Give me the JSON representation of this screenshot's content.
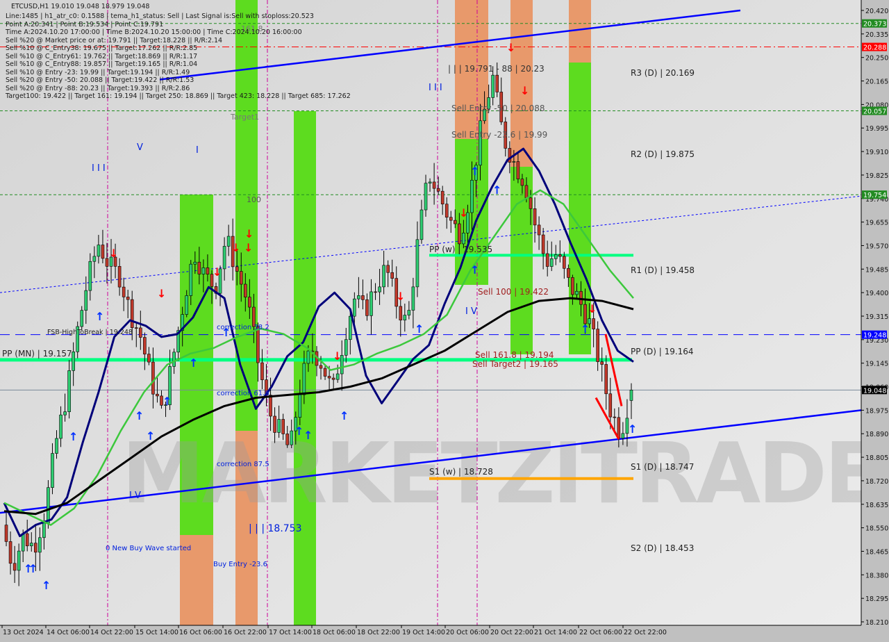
{
  "header": {
    "symbol_line": "ETCUSD,H1  19.010 19.048 18.979 19.048",
    "info_lines": [
      "Line:1485 | h1_atr_c0: 0.1588 | tema_h1_status: Sell | Last Signal is:Sell with stoploss:20.523",
      "Point A:20.341 | Point B:19.534 | Point C:19.791",
      "Time A:2024.10.20 17:00:00 | Time B:2024.10.20 15:00:00 | Time C:2024.10.20 16:00:00",
      "Sell %20 @ Market price or at: 19.791 || Target:18.228 || R/R:2.14",
      "Sell %10 @ C_Entry38: 19.675 || Target:17.262 || R/R:2.85",
      "Sell %10 @ C_Entry61: 19.762 || Target:18.869 || R/R:1.17",
      "Sell %10 @ C_Entry88: 19.857 || Target:19.165 || R/R:1.04",
      "Sell %10 @ Entry -23: 19.99 || Target:19.194 || R/R:1.49",
      "Sell %20 @ Entry -50: 20.088 || Target:19.422 || R/R:1.53",
      "Sell %20 @ Entry -88: 20.23 || Target:19.393 || R/R:2.86",
      "Target100: 19.422 || Target 161: 19.194 || Target 250: 18.869 || Target 423: 18.228 || Target 685: 17.262"
    ]
  },
  "watermark": "MARKETZITRADE",
  "colors": {
    "background": "#d8d8d8",
    "bull_candle": "#2ecc71",
    "bear_candle": "#c0392b",
    "green_zone": "#5ddc1f",
    "orange_zone": "#e8996b",
    "pivot_line": "#00ff80",
    "s1w_line": "#ffa500",
    "channel": "#0000ff",
    "ma_fast": "#00007a",
    "ma_mid": "#3cc83c",
    "ma_slow": "#000000",
    "price_tag": "#000000",
    "red_tag": "#ff0000",
    "green_tag": "#228b22",
    "blue_tag": "#0000ff"
  },
  "chart_data": {
    "type": "candlestick",
    "title": "ETCUSD,H1",
    "ylim": [
      18.21,
      20.42
    ],
    "y_ticks": [
      "20.420",
      "20.335",
      "20.250",
      "20.165",
      "20.080",
      "19.995",
      "19.910",
      "19.825",
      "19.740",
      "19.655",
      "19.570",
      "19.485",
      "19.400",
      "19.315",
      "19.230",
      "19.145",
      "19.060",
      "18.975",
      "18.890",
      "18.805",
      "18.720",
      "18.635",
      "18.550",
      "18.465",
      "18.380",
      "18.295",
      "18.210"
    ],
    "x_ticks": [
      "13 Oct 2024",
      "14 Oct 06:00",
      "14 Oct 22:00",
      "15 Oct 14:00",
      "16 Oct 06:00",
      "16 Oct 22:00",
      "17 Oct 14:00",
      "18 Oct 06:00",
      "18 Oct 22:00",
      "19 Oct 14:00",
      "20 Oct 06:00",
      "20 Oct 22:00",
      "21 Oct 14:00",
      "22 Oct 06:00",
      "22 Oct 22:00"
    ],
    "last_price": 19.048,
    "ohlc_last": {
      "open": 19.01,
      "high": 19.048,
      "low": 18.979,
      "close": 19.048
    },
    "price_tags": [
      {
        "value": 20.373,
        "label": "20.373",
        "kind": "green"
      },
      {
        "value": 20.288,
        "label": "20.288",
        "kind": "red"
      },
      {
        "value": 20.057,
        "label": "20.057",
        "kind": "green"
      },
      {
        "value": 19.754,
        "label": "19.754",
        "kind": "green"
      },
      {
        "value": 19.248,
        "label": "19.248",
        "kind": "blue"
      },
      {
        "value": 19.048,
        "label": "19.048",
        "kind": "price"
      }
    ],
    "levels": [
      {
        "name": "R3 (D)",
        "value": 20.169,
        "label": "R3 (D) | 20.169"
      },
      {
        "name": "R2 (D)",
        "value": 19.875,
        "label": "R2 (D) | 19.875"
      },
      {
        "name": "R1 (D)",
        "value": 19.458,
        "label": "R1 (D) | 19.458"
      },
      {
        "name": "PP (D)",
        "value": 19.164,
        "label": "PP (D) | 19.164"
      },
      {
        "name": "S1 (D)",
        "value": 18.747,
        "label": "S1 (D) | 18.747"
      },
      {
        "name": "S2 (D)",
        "value": 18.453,
        "label": "S2 (D) | 18.453"
      },
      {
        "name": "PP (MN)",
        "value": 19.157,
        "label": "PP (MN) | 19.157"
      },
      {
        "name": "PP (w)",
        "value": 19.535,
        "label": "PP (w) | 19.535"
      },
      {
        "name": "S1 (w)",
        "value": 18.728,
        "label": "S1 (w) | 18.728"
      }
    ],
    "annotations": [
      {
        "text": "| | | 19.791 - 88 | 20.23",
        "value": 20.23
      },
      {
        "text": "Sell Entry -50 | 20.088",
        "value": 20.088
      },
      {
        "text": "Sell Entry -23.6 | 19.99",
        "value": 19.99
      },
      {
        "text": "Sell 100 | 19.422",
        "value": 19.422
      },
      {
        "text": "Sell 161.8 | 19.194",
        "value": 19.194
      },
      {
        "text": "Sell Target2 | 19.165",
        "value": 19.165
      },
      {
        "text": "FSB-HighToBreak | 19.248",
        "value": 19.248
      },
      {
        "text": "correction 38.2",
        "value": 19.27
      },
      {
        "text": "correction 61.8",
        "value": 19.045
      },
      {
        "text": "correction 87.5",
        "value": 18.84
      },
      {
        "text": "| | | 18.753",
        "value": 18.53
      },
      {
        "text": "0 New Buy Wave started",
        "value": 18.43
      },
      {
        "text": "Buy Entry -23.6",
        "value": 18.38
      },
      {
        "text": "Target1",
        "value": 20.02
      },
      {
        "text": "100",
        "value": 19.7
      },
      {
        "text": "161.8",
        "value": 20.36
      },
      {
        "text": "I I I",
        "value": 19.86
      },
      {
        "text": "V",
        "value": 19.95
      },
      {
        "text": "I",
        "value": 19.94
      },
      {
        "text": "I I I",
        "value": 20.17
      },
      {
        "text": "I V",
        "value": 19.31
      },
      {
        "text": "I V",
        "value": 18.69
      }
    ],
    "series": [
      {
        "name": "Close (approx.)",
        "values": [
          18.56,
          18.41,
          18.52,
          18.48,
          18.6,
          18.85,
          19.02,
          19.25,
          19.44,
          19.58,
          19.5,
          19.46,
          19.33,
          19.24,
          19.08,
          18.96,
          19.16,
          19.36,
          19.55,
          19.46,
          19.42,
          19.6,
          19.48,
          19.37,
          19.15,
          18.97,
          18.9,
          18.83,
          19.07,
          19.2,
          19.14,
          19.04,
          19.23,
          19.38,
          19.33,
          19.42,
          19.49,
          19.36,
          19.28,
          19.59,
          19.83,
          19.75,
          19.66,
          19.61,
          19.78,
          20.02,
          20.18,
          19.96,
          19.87,
          19.8,
          19.64,
          19.51,
          19.54,
          19.44,
          19.38,
          19.3,
          19.15,
          18.98,
          18.89,
          19.048
        ]
      },
      {
        "name": "MA fast",
        "values": [
          18.64,
          18.52,
          18.56,
          18.58,
          18.66,
          18.86,
          19.04,
          19.24,
          19.3,
          19.28,
          19.24,
          19.25,
          19.31,
          19.42,
          19.38,
          19.14,
          18.98,
          19.06,
          19.17,
          19.22,
          19.35,
          19.4,
          19.34,
          19.1,
          19.0,
          19.08,
          19.16,
          19.21,
          19.36,
          19.49,
          19.66,
          19.78,
          19.88,
          19.92,
          19.84,
          19.72,
          19.58,
          19.45,
          19.3,
          19.19,
          19.15
        ]
      },
      {
        "name": "MA mid",
        "values": [
          18.64,
          18.6,
          18.56,
          18.62,
          18.74,
          18.9,
          19.04,
          19.14,
          19.18,
          19.2,
          19.24,
          19.27,
          19.25,
          19.2,
          19.12,
          19.14,
          19.18,
          19.21,
          19.25,
          19.32,
          19.48,
          19.6,
          19.72,
          19.77,
          19.72,
          19.6,
          19.48,
          19.38
        ]
      },
      {
        "name": "MA slow",
        "values": [
          18.61,
          18.6,
          18.64,
          18.72,
          18.8,
          18.88,
          18.94,
          18.99,
          19.02,
          19.03,
          19.04,
          19.06,
          19.09,
          19.14,
          19.19,
          19.26,
          19.33,
          19.37,
          19.38,
          19.37,
          19.34
        ]
      }
    ]
  }
}
